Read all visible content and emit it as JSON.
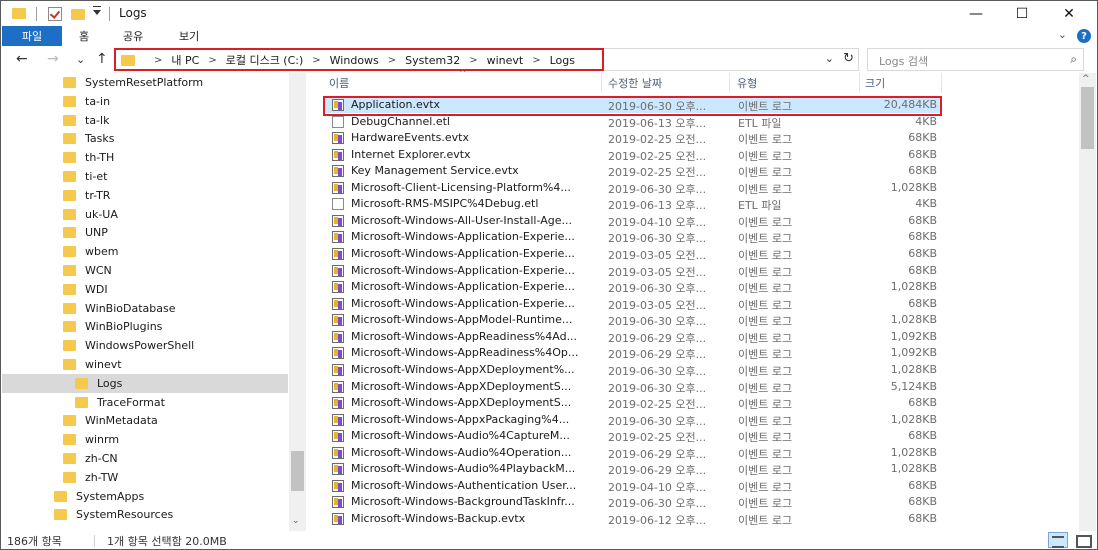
{
  "window": {
    "title": "Logs",
    "minimize": "—",
    "maximize": "☐",
    "close": "✕"
  },
  "ribbon": {
    "tabs": [
      "파일",
      "홈",
      "공유",
      "보기"
    ],
    "collapse": "⌄",
    "help": "?"
  },
  "nav": {
    "back": "←",
    "forward": "→",
    "history": "⌄",
    "up": "↑"
  },
  "address": {
    "crumbs": [
      "내 PC",
      "로컬 디스크 (C:)",
      "Windows",
      "System32",
      "winevt",
      "Logs"
    ],
    "separator": ">",
    "dropdown": "⌄",
    "refresh": "↻"
  },
  "search": {
    "placeholder": "Logs 검색",
    "icon": "search-icon"
  },
  "tree": {
    "items": [
      {
        "label": "SystemResetPlatform",
        "indent": 2
      },
      {
        "label": "ta-in",
        "indent": 2
      },
      {
        "label": "ta-lk",
        "indent": 2
      },
      {
        "label": "Tasks",
        "indent": 2
      },
      {
        "label": "th-TH",
        "indent": 2
      },
      {
        "label": "ti-et",
        "indent": 2
      },
      {
        "label": "tr-TR",
        "indent": 2
      },
      {
        "label": "uk-UA",
        "indent": 2
      },
      {
        "label": "UNP",
        "indent": 2
      },
      {
        "label": "wbem",
        "indent": 2
      },
      {
        "label": "WCN",
        "indent": 2
      },
      {
        "label": "WDI",
        "indent": 2
      },
      {
        "label": "WinBioDatabase",
        "indent": 2
      },
      {
        "label": "WinBioPlugins",
        "indent": 2
      },
      {
        "label": "WindowsPowerShell",
        "indent": 2
      },
      {
        "label": "winevt",
        "indent": 2
      },
      {
        "label": "Logs",
        "indent": 3,
        "selected": true
      },
      {
        "label": "TraceFormat",
        "indent": 3
      },
      {
        "label": "WinMetadata",
        "indent": 2
      },
      {
        "label": "winrm",
        "indent": 2
      },
      {
        "label": "zh-CN",
        "indent": 2
      },
      {
        "label": "zh-TW",
        "indent": 2
      },
      {
        "label": "SystemApps",
        "indent": 1
      },
      {
        "label": "SystemResources",
        "indent": 1
      }
    ]
  },
  "columns": {
    "name": "이름",
    "date": "수정한 날짜",
    "type": "유형",
    "size": "크기"
  },
  "files": [
    {
      "name": "Application.evtx",
      "date": "2019-06-30 오후...",
      "type": "이벤트 로그",
      "size": "20,484KB",
      "kind": "evtx",
      "selected": true
    },
    {
      "name": "DebugChannel.etl",
      "date": "2019-06-13 오후...",
      "type": "ETL 파일",
      "size": "4KB",
      "kind": "etl"
    },
    {
      "name": "HardwareEvents.evtx",
      "date": "2019-02-25 오전...",
      "type": "이벤트 로그",
      "size": "68KB",
      "kind": "evtx"
    },
    {
      "name": "Internet Explorer.evtx",
      "date": "2019-02-25 오전...",
      "type": "이벤트 로그",
      "size": "68KB",
      "kind": "evtx"
    },
    {
      "name": "Key Management Service.evtx",
      "date": "2019-02-25 오전...",
      "type": "이벤트 로그",
      "size": "68KB",
      "kind": "evtx"
    },
    {
      "name": "Microsoft-Client-Licensing-Platform%4...",
      "date": "2019-06-30 오후...",
      "type": "이벤트 로그",
      "size": "1,028KB",
      "kind": "evtx"
    },
    {
      "name": "Microsoft-RMS-MSIPC%4Debug.etl",
      "date": "2019-06-13 오후...",
      "type": "ETL 파일",
      "size": "4KB",
      "kind": "etl"
    },
    {
      "name": "Microsoft-Windows-All-User-Install-Age...",
      "date": "2019-04-10 오후...",
      "type": "이벤트 로그",
      "size": "68KB",
      "kind": "evtx"
    },
    {
      "name": "Microsoft-Windows-Application-Experie...",
      "date": "2019-06-30 오후...",
      "type": "이벤트 로그",
      "size": "68KB",
      "kind": "evtx"
    },
    {
      "name": "Microsoft-Windows-Application-Experie...",
      "date": "2019-03-05 오전...",
      "type": "이벤트 로그",
      "size": "68KB",
      "kind": "evtx"
    },
    {
      "name": "Microsoft-Windows-Application-Experie...",
      "date": "2019-03-05 오전...",
      "type": "이벤트 로그",
      "size": "68KB",
      "kind": "evtx"
    },
    {
      "name": "Microsoft-Windows-Application-Experie...",
      "date": "2019-06-30 오후...",
      "type": "이벤트 로그",
      "size": "1,028KB",
      "kind": "evtx"
    },
    {
      "name": "Microsoft-Windows-Application-Experie...",
      "date": "2019-03-05 오전...",
      "type": "이벤트 로그",
      "size": "68KB",
      "kind": "evtx"
    },
    {
      "name": "Microsoft-Windows-AppModel-Runtime...",
      "date": "2019-06-30 오후...",
      "type": "이벤트 로그",
      "size": "1,028KB",
      "kind": "evtx"
    },
    {
      "name": "Microsoft-Windows-AppReadiness%4Ad...",
      "date": "2019-06-29 오후...",
      "type": "이벤트 로그",
      "size": "1,092KB",
      "kind": "evtx"
    },
    {
      "name": "Microsoft-Windows-AppReadiness%4Op...",
      "date": "2019-06-29 오후...",
      "type": "이벤트 로그",
      "size": "1,092KB",
      "kind": "evtx"
    },
    {
      "name": "Microsoft-Windows-AppXDeployment%...",
      "date": "2019-06-30 오후...",
      "type": "이벤트 로그",
      "size": "1,028KB",
      "kind": "evtx"
    },
    {
      "name": "Microsoft-Windows-AppXDeploymentS...",
      "date": "2019-06-30 오후...",
      "type": "이벤트 로그",
      "size": "5,124KB",
      "kind": "evtx"
    },
    {
      "name": "Microsoft-Windows-AppXDeploymentS...",
      "date": "2019-02-25 오전...",
      "type": "이벤트 로그",
      "size": "68KB",
      "kind": "evtx"
    },
    {
      "name": "Microsoft-Windows-AppxPackaging%4...",
      "date": "2019-06-30 오후...",
      "type": "이벤트 로그",
      "size": "1,028KB",
      "kind": "evtx"
    },
    {
      "name": "Microsoft-Windows-Audio%4CaptureM...",
      "date": "2019-02-25 오전...",
      "type": "이벤트 로그",
      "size": "68KB",
      "kind": "evtx"
    },
    {
      "name": "Microsoft-Windows-Audio%4Operation...",
      "date": "2019-06-29 오후...",
      "type": "이벤트 로그",
      "size": "1,028KB",
      "kind": "evtx"
    },
    {
      "name": "Microsoft-Windows-Audio%4PlaybackM...",
      "date": "2019-06-29 오후...",
      "type": "이벤트 로그",
      "size": "1,028KB",
      "kind": "evtx"
    },
    {
      "name": "Microsoft-Windows-Authentication User...",
      "date": "2019-04-10 오후...",
      "type": "이벤트 로그",
      "size": "68KB",
      "kind": "evtx"
    },
    {
      "name": "Microsoft-Windows-BackgroundTaskInfr...",
      "date": "2019-06-30 오후...",
      "type": "이벤트 로그",
      "size": "68KB",
      "kind": "evtx"
    },
    {
      "name": "Microsoft-Windows-Backup.evtx",
      "date": "2019-06-12 오후...",
      "type": "이벤트 로그",
      "size": "68KB",
      "kind": "evtx"
    }
  ],
  "status": {
    "item_count": "186개 항목",
    "selection": "1개 항목 선택함 20.0MB"
  },
  "colors": {
    "accent": "#1c6fc4",
    "highlight_box": "#d71f27",
    "selection": "#cce8ff"
  }
}
